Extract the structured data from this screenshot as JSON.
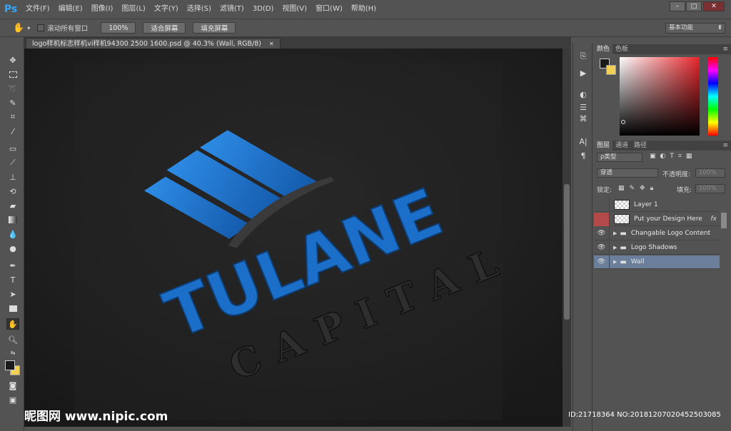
{
  "app": {
    "logo": "Ps"
  },
  "menu": [
    "文件(F)",
    "编辑(E)",
    "图像(I)",
    "图层(L)",
    "文字(Y)",
    "选择(S)",
    "滤镜(T)",
    "3D(D)",
    "视图(V)",
    "窗口(W)",
    "帮助(H)"
  ],
  "window_controls": {
    "minimize": "–",
    "restore": "□",
    "close": "✕"
  },
  "options": {
    "scroll_all_windows": "滚动所有窗口",
    "zoom100": "100%",
    "fit_screen": "适合屏幕",
    "fill_screen": "填充屏幕",
    "workspace": "基本功能"
  },
  "document": {
    "tab_title": "logo样机标志样机vi样机94300 2500 1600.psd @ 40.3% (Wall, RGB/8)",
    "tab_close": "✕"
  },
  "artwork": {
    "word1": "TULANE",
    "word2": "CAPITAL"
  },
  "color_panel": {
    "tabs": [
      "颜色",
      "色板"
    ],
    "accent": "#1f6fc4",
    "foreground": "#1a1a1a",
    "background": "#f1d155"
  },
  "layers_panel": {
    "tabs": [
      "图层",
      "通道",
      "路径"
    ],
    "filter_label": "ρ类型",
    "blend_mode": "穿透",
    "opacity_label": "不透明度:",
    "opacity_value": "100%",
    "lock_label": "锁定:",
    "fill_label": "填充:",
    "fill_value": "100%",
    "layers": [
      {
        "name": "Layer 1",
        "visible": false
      },
      {
        "name": "Put your Design Here",
        "visible": false,
        "fx": "fx"
      },
      {
        "name": "Changable Logo Content",
        "visible": true
      },
      {
        "name": "Logo Shadows",
        "visible": true
      },
      {
        "name": "Wall",
        "visible": true
      }
    ]
  },
  "watermark": {
    "left": "昵图网 www.nipic.com",
    "right": "ID:21718364 NO:20181207020452503085"
  }
}
